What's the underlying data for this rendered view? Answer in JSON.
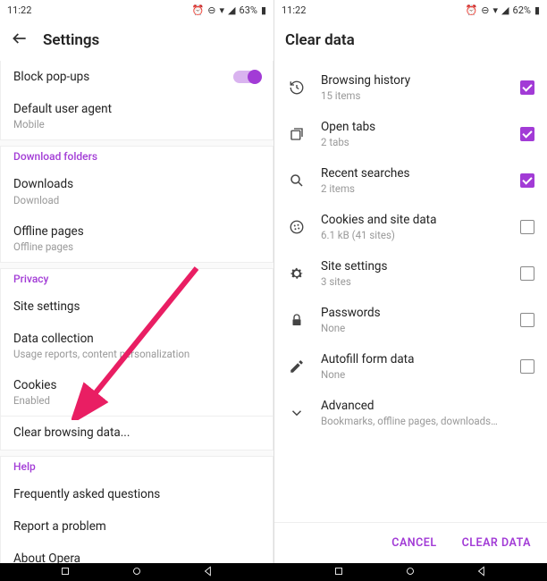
{
  "left": {
    "status": {
      "time": "11:22",
      "battery": "63%"
    },
    "title": "Settings",
    "block_popups": "Block pop-ups",
    "default_ua": {
      "label": "Default user agent",
      "sub": "Mobile"
    },
    "download_folders": "Download folders",
    "downloads": {
      "label": "Downloads",
      "sub": "Download"
    },
    "offline": {
      "label": "Offline pages",
      "sub": "Offline pages"
    },
    "privacy": "Privacy",
    "site_settings": "Site settings",
    "data_collection": {
      "label": "Data collection",
      "sub": "Usage reports, content personalization"
    },
    "cookies": {
      "label": "Cookies",
      "sub": "Enabled"
    },
    "clear_browsing": "Clear browsing data...",
    "help": "Help",
    "faq": "Frequently asked questions",
    "report": "Report a problem",
    "about": "About Opera"
  },
  "right": {
    "status": {
      "time": "11:22",
      "battery": "62%"
    },
    "title": "Clear data",
    "items": [
      {
        "label": "Browsing history",
        "sub": "15 items",
        "checked": true,
        "icon": "history"
      },
      {
        "label": "Open tabs",
        "sub": "2 tabs",
        "checked": true,
        "icon": "tabs"
      },
      {
        "label": "Recent searches",
        "sub": "2 items",
        "checked": true,
        "icon": "search"
      },
      {
        "label": "Cookies and site data",
        "sub": "6.1 kB (41 sites)",
        "checked": false,
        "icon": "cookie"
      },
      {
        "label": "Site settings",
        "sub": "3 sites",
        "checked": false,
        "icon": "gear"
      },
      {
        "label": "Passwords",
        "sub": "None",
        "checked": false,
        "icon": "lock"
      },
      {
        "label": "Autofill form data",
        "sub": "None",
        "checked": false,
        "icon": "pencil"
      }
    ],
    "advanced": {
      "label": "Advanced",
      "sub": "Bookmarks, offline pages, downloads…"
    },
    "cancel": "CANCEL",
    "clear": "CLEAR DATA"
  }
}
